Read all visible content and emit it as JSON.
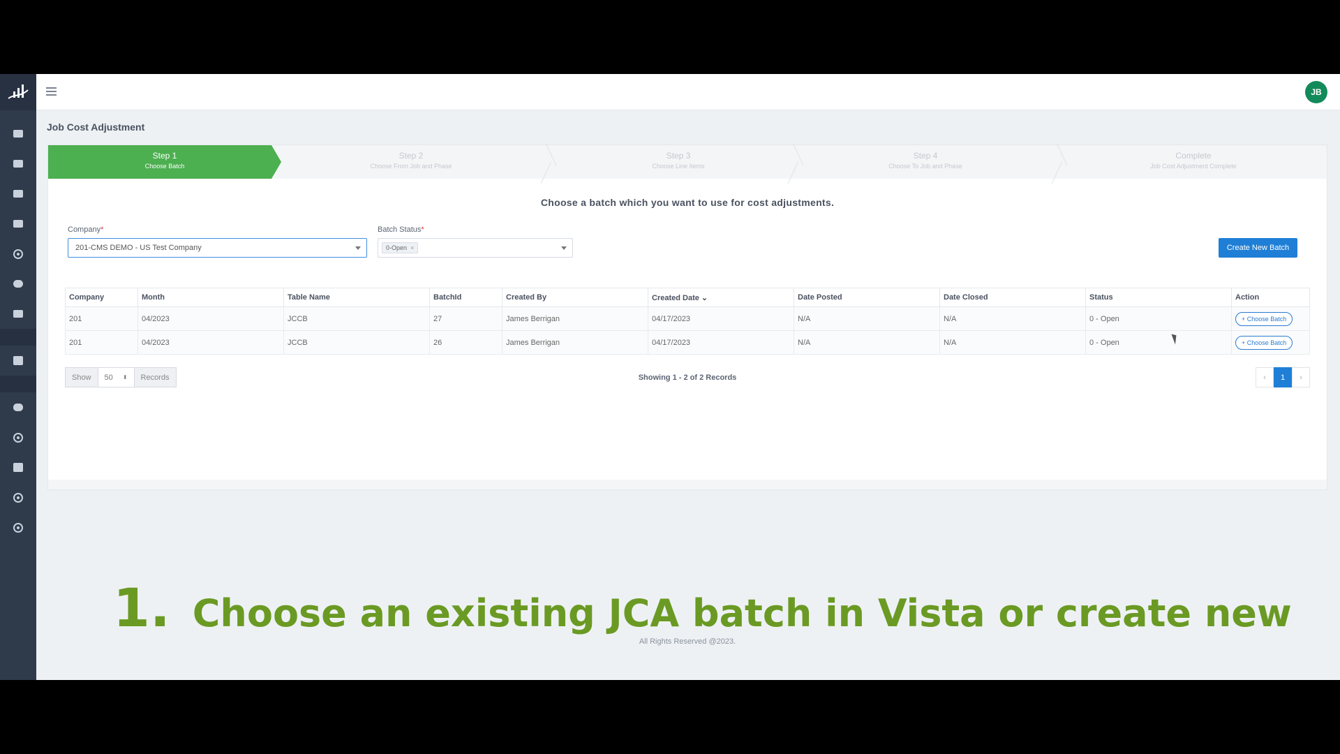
{
  "header": {
    "avatar_initials": "JB"
  },
  "page": {
    "title": "Job Cost Adjustment"
  },
  "steps": [
    {
      "title": "Step 1",
      "subtitle": "Choose Batch",
      "active": true
    },
    {
      "title": "Step 2",
      "subtitle": "Choose From Job and Phase",
      "active": false
    },
    {
      "title": "Step 3",
      "subtitle": "Choose Line Items",
      "active": false
    },
    {
      "title": "Step 4",
      "subtitle": "Choose To Job and Phase",
      "active": false
    },
    {
      "title": "Complete",
      "subtitle": "Job Cost Adjustment Complete",
      "active": false
    }
  ],
  "form": {
    "instruction": "Choose a batch which you want to use for cost adjustments.",
    "company_label": "Company",
    "company_value": "201-CMS DEMO - US Test Company",
    "batch_status_label": "Batch Status",
    "batch_status_chip": "0-Open",
    "required_mark": "*",
    "create_button": "Create New Batch"
  },
  "table": {
    "headers": [
      "Company",
      "Month",
      "Table Name",
      "BatchId",
      "Created By",
      "Created Date",
      "Date Posted",
      "Date Closed",
      "Status",
      "Action"
    ],
    "rows": [
      [
        "201",
        "04/2023",
        "JCCB",
        "27",
        "James Berrigan",
        "04/17/2023",
        "N/A",
        "N/A",
        "0 - Open",
        "+ Choose Batch"
      ],
      [
        "201",
        "04/2023",
        "JCCB",
        "26",
        "James Berrigan",
        "04/17/2023",
        "N/A",
        "N/A",
        "0 - Open",
        "+ Choose Batch"
      ]
    ]
  },
  "pagination": {
    "show_label": "Show",
    "page_size": "50",
    "records_label": "Records",
    "summary": "Showing 1 - 2 of 2 Records",
    "prev": "‹",
    "current_page": "1",
    "next": "›"
  },
  "footer": {
    "copyright": "All Rights Reserved @2023."
  },
  "caption": {
    "number": "1.",
    "text": "Choose an existing JCA batch in Vista or create new"
  },
  "colors": {
    "accent": "#1f7fd6",
    "step_active": "#4caf50",
    "caption": "#6a9a23",
    "sidebar": "#2f3a4b"
  }
}
